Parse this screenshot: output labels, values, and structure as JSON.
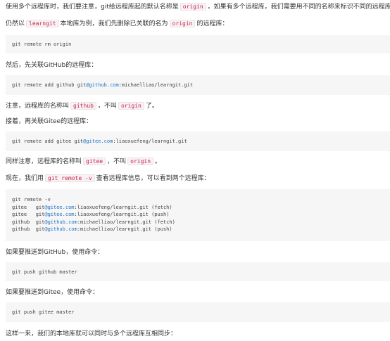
{
  "doc": {
    "p1": {
      "a": "使用多个远程库时，我们要注意，git给远程库起的默认名称是",
      "c1": "origin",
      "b": "，如果有多个远程库，我们需要用不同的名称来标识不同的远程库。"
    },
    "p2": {
      "a": "仍然以",
      "c1": "learngit",
      "b": "本地库为例，我们先删除已关联的名为",
      "c2": "origin",
      "c": "的远程库："
    },
    "code1": "git remote rm origin",
    "p3": "然后，先关联GitHub的远程库：",
    "code2": {
      "a": "git remote add github git",
      "b": "@github.com",
      "c": ":michaelliao/learngit.git"
    },
    "p4": {
      "a": "注意，远程库的名称叫",
      "c1": "github",
      "b": "，不叫",
      "c2": "origin",
      "c": "了。"
    },
    "p5": "接着，再关联Gitee的远程库：",
    "code3": {
      "a": "git remote add gitee git",
      "b": "@gitee.com",
      "c": ":liaoxuefeng/learngit.git"
    },
    "p6": {
      "a": "同样注意，远程库的名称叫",
      "c1": "gitee",
      "b": "，不叫",
      "c2": "origin",
      "c": "。"
    },
    "p7": {
      "a": "现在，我们用",
      "c1": "git remote -v",
      "b": "查看远程库信息，可以看到两个远程库："
    },
    "code4": [
      {
        "a": "git remote -v",
        "b": "",
        "c": ""
      },
      {
        "a": "gitee   git",
        "b": "@gitee.com",
        "c": ":liaoxuefeng/learngit.git (fetch)"
      },
      {
        "a": "gitee   git",
        "b": "@gitee.com",
        "c": ":liaoxuefeng/learngit.git (push)"
      },
      {
        "a": "github  git",
        "b": "@github.com",
        "c": ":michaelliao/learngit.git (fetch)"
      },
      {
        "a": "github  git",
        "b": "@github.com",
        "c": ":michaelliao/learngit.git (push)"
      }
    ],
    "p8": "如果要推送到GitHub，使用命令：",
    "code5": "git push github master",
    "p9": "如果要推送到Gitee，使用命令：",
    "code6": "git push gitee master",
    "p10": "这样一来，我们的本地库就可以同时与多个远程库互相同步："
  },
  "colors": {
    "text": "#333333",
    "code_bg": "#f6f6f6",
    "inline_code": "#c7254e",
    "link": "#1a73c5"
  }
}
